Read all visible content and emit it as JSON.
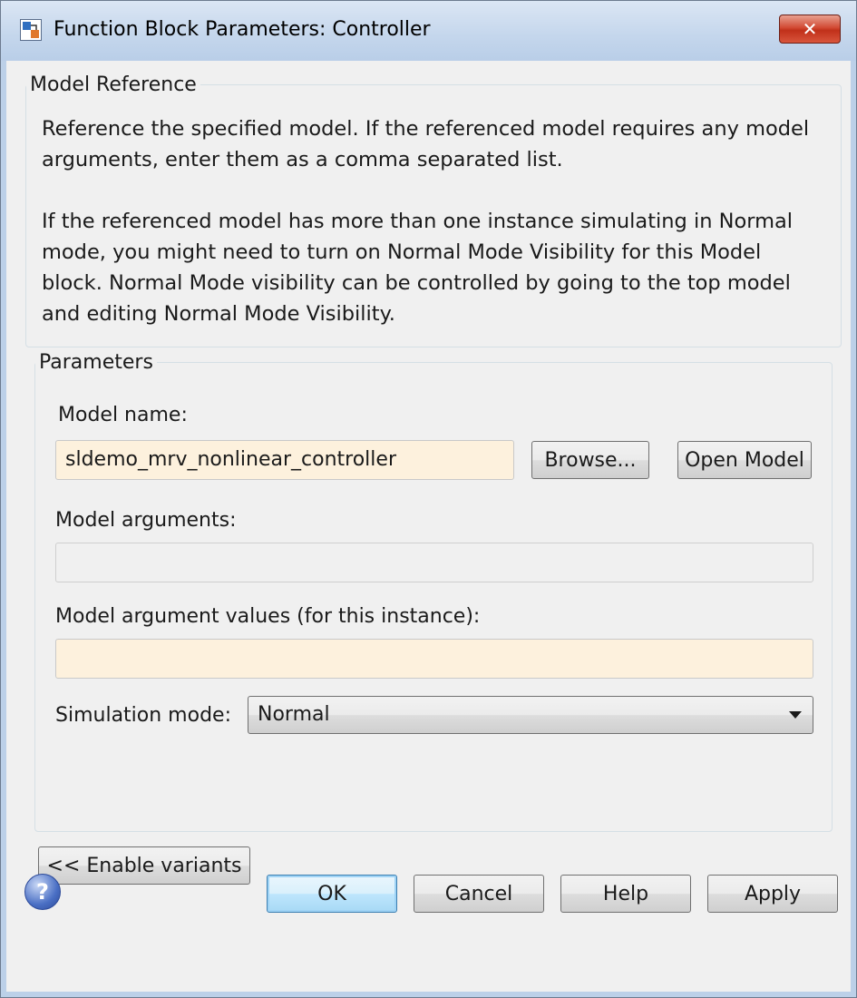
{
  "window": {
    "title": "Function Block Parameters: Controller",
    "close_symbol": "✕"
  },
  "model_reference": {
    "legend": "Model Reference",
    "description_lines": [
      "Reference the specified model. If the referenced model requires any model",
      "arguments, enter them as a comma separated list.",
      "If the referenced model has more than one instance simulating in Normal",
      "mode, you might need to turn on Normal Mode Visibility for this Model",
      "block. Normal Mode visibility can be controlled by going to the top model",
      "and editing Normal Mode Visibility."
    ]
  },
  "parameters": {
    "legend": "Parameters",
    "model_name_label": "Model name:",
    "model_name_value": "sldemo_mrv_nonlinear_controller",
    "browse_label": "Browse...",
    "open_model_label": "Open Model",
    "model_arguments_label": "Model arguments:",
    "model_arguments_value": "",
    "model_argument_values_label": "Model argument values (for this instance):",
    "model_argument_values_value": "",
    "simulation_mode_label": "Simulation mode:",
    "simulation_mode_value": "Normal"
  },
  "enable_variants_label": "<< Enable variants",
  "footer": {
    "help_icon_glyph": "?",
    "ok_label": "OK",
    "cancel_label": "Cancel",
    "help_label": "Help",
    "apply_label": "Apply"
  },
  "colors": {
    "editable_field_bg": "#fdf1dd",
    "dialog_bg": "#f0f0f0",
    "close_button": "#c0301a",
    "default_button_border": "#3c7fb1"
  }
}
